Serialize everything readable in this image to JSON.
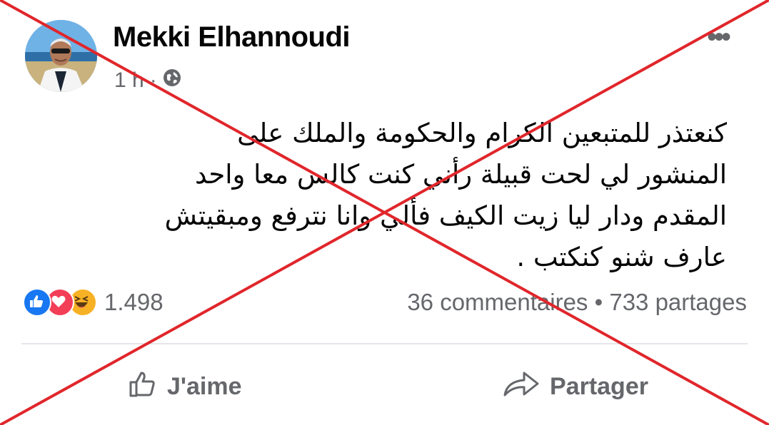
{
  "post": {
    "author": "Mekki Elhannoudi",
    "time": "1 h",
    "separator": "·",
    "more_label": "•••",
    "body_lines": [
      "كنعتذر للمتبعين الكرام والحكومة والملك على",
      "المنشور لي لحت قبيلة رأني كنت كالس معا واحد",
      "المقدم ودار ليا زيت الكيف فألي وانا نترفع ومبقيتش",
      "عارف شنو كنكتب ."
    ]
  },
  "reactions": {
    "icons": [
      "like-icon",
      "love-icon",
      "haha-icon"
    ],
    "count": "1.498",
    "comments": "36 commentaires",
    "shares": "733 partages",
    "dot": "•"
  },
  "actions": {
    "like_label": "J'aime",
    "share_label": "Partager"
  },
  "colors": {
    "like": "#1877f2",
    "love": "#f33e58",
    "haha": "#f7b125",
    "cross": "#e0262b",
    "meta_text": "#65676b"
  }
}
